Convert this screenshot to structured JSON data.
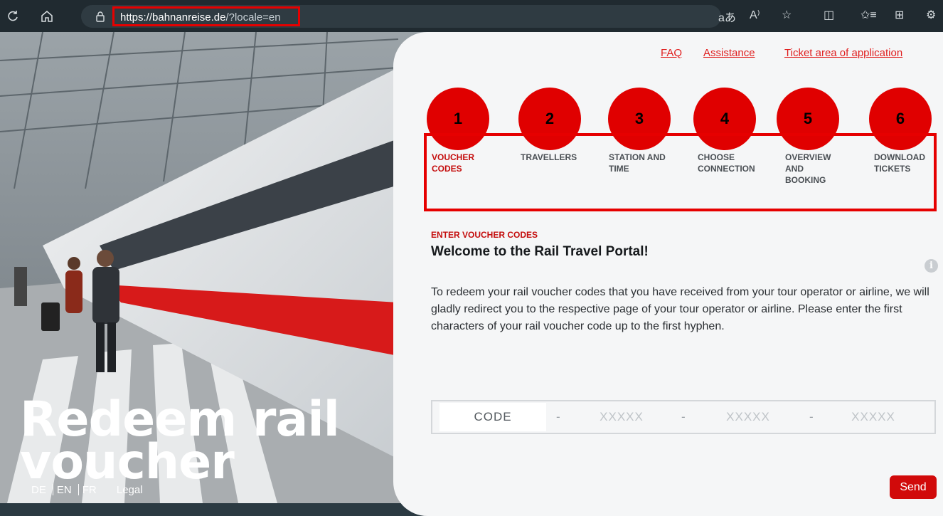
{
  "browser": {
    "url_domain": "https://bahnanreise.de",
    "url_path": "/?locale=en",
    "icons": [
      "refresh-icon",
      "home-icon",
      "lock-icon",
      "translate-icon",
      "read-aloud-icon",
      "star-icon",
      "split-screen-icon",
      "favorites-icon",
      "collections-icon",
      "extensions-icon"
    ]
  },
  "hero": {
    "title_line1": "Redeem rail",
    "title_line2": "voucher",
    "lang_de": "DE",
    "lang_en": "EN",
    "lang_fr": "FR",
    "legal": "Legal"
  },
  "top_links": {
    "faq": "FAQ",
    "assistance": "Assistance",
    "ticket_area": "Ticket area of application"
  },
  "steps": [
    {
      "number": "1",
      "label": "VOUCHER CODES",
      "active": true
    },
    {
      "number": "2",
      "label": "TRAVELLERS",
      "active": false
    },
    {
      "number": "3",
      "label": "STATION AND TIME",
      "active": false
    },
    {
      "number": "4",
      "label": "CHOOSE CONNECTION",
      "active": false
    },
    {
      "number": "5",
      "label": "OVERVIEW AND BOOKING",
      "active": false
    },
    {
      "number": "6",
      "label": "DOWNLOAD TICKETS",
      "active": false
    }
  ],
  "main": {
    "kicker": "ENTER VOUCHER CODES",
    "headline": "Welcome to the Rail Travel Portal!",
    "body": "To redeem your rail voucher codes that you have received from your tour operator or airline, we will gladly redirect you to the respective page of your tour operator or airline. Please enter the first characters of your rail voucher code up to the first hyphen.",
    "code_placeholder": "CODE",
    "segment_placeholder_1": "XXXXX",
    "segment_placeholder_2": "XXXXX",
    "segment_placeholder_3": "XXXXX",
    "dash": "-",
    "send_label": "Send"
  },
  "colors": {
    "accent": "#d10a0a",
    "annotation": "#e60000"
  }
}
